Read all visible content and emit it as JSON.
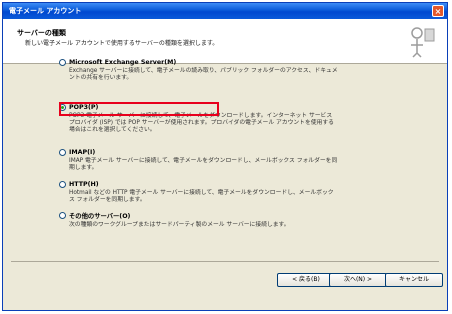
{
  "window": {
    "title": "電子メール アカウント",
    "close_glyph": "×"
  },
  "header": {
    "title": "サーバーの種類",
    "subtitle": "新しい電子メール アカウントで使用するサーバーの種類を選択します。"
  },
  "options": [
    {
      "label": "Microsoft Exchange Server(M)",
      "description": "Exchange サーバーに接続して、電子メールの読み取り、パブリック フォルダーのアクセス、ドキュメントの共有を行います。",
      "checked": false
    },
    {
      "label": "POP3(P)",
      "description": "POP3 電子メール サーバーに接続して、電子メールをダウンロードします。インターネット サービス プロバイダ (ISP) では POP サーバーが使用されます。プロバイダの電子メール アカウントを使用する場合はこれを選択してください。",
      "checked": true
    },
    {
      "label": "IMAP(I)",
      "description": "IMAP 電子メール サーバーに接続して、電子メールをダウンロードし、メールボックス フォルダーを同期します。",
      "checked": false
    },
    {
      "label": "HTTP(H)",
      "description": "Hotmail などの HTTP 電子メール サーバーに接続して、電子メールをダウンロードし、メールボックス フォルダーを同期します。",
      "checked": false
    },
    {
      "label": "その他のサーバー(O)",
      "description": "次の種類のワークグループまたはサードパーティ製のメール サーバーに接続します。",
      "checked": false
    }
  ],
  "buttons": {
    "back": "< 戻る(B)",
    "next": "次へ(N) >",
    "cancel": "キャンセル"
  },
  "colors": {
    "highlight": "#e8001c",
    "titlebar": "#0a5ad9",
    "dialog_bg": "#ece9d8"
  }
}
